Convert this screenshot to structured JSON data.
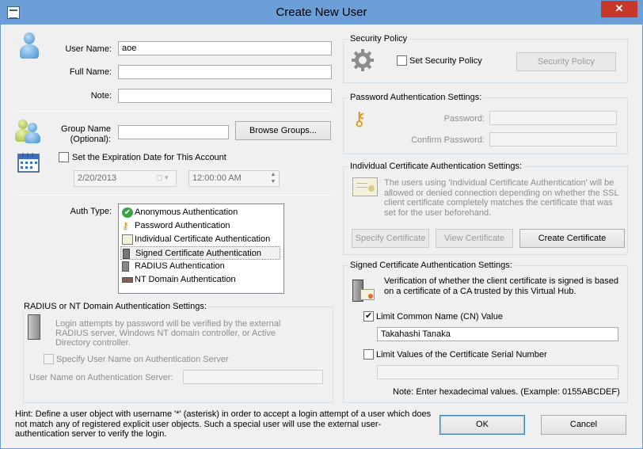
{
  "window": {
    "title": "Create New User",
    "close_glyph": "✕"
  },
  "user": {
    "username_label": "User Name:",
    "username_value": "aoe",
    "fullname_label": "Full Name:",
    "fullname_value": "",
    "note_label": "Note:",
    "note_value": ""
  },
  "group": {
    "label_line1": "Group Name",
    "label_line2": "(Optional):",
    "value": "",
    "browse_button": "Browse Groups..."
  },
  "expiration": {
    "checkbox_label": "Set the Expiration Date for This Account",
    "checked": false,
    "date_value": "2/20/2013",
    "time_value": "12:00:00 AM"
  },
  "auth_type": {
    "label": "Auth Type:",
    "items": [
      "Anonymous Authentication",
      "Password Authentication",
      "Individual Certificate Authentication",
      "Signed Certificate Authentication",
      "RADIUS Authentication",
      "NT Domain Authentication"
    ],
    "selected_index": 3
  },
  "radius": {
    "title": "RADIUS or NT Domain Authentication Settings:",
    "description": "Login attempts by password will be verified by the external RADIUS server, Windows NT domain controller, or Active Directory controller.",
    "specify_checkbox": "Specify User Name on Authentication Server",
    "server_username_label": "User Name on Authentication Server:",
    "server_username_value": ""
  },
  "hint": "Hint: Define a user object with username '*' (asterisk) in order to accept a login attempt of a user which does not match any of registered explicit user objects. Such a special user will use the external user-authentication server to verify the login.",
  "security_policy": {
    "title": "Security Policy",
    "checkbox_label": "Set Security Policy",
    "button": "Security Policy"
  },
  "password_auth": {
    "title": "Password Authentication Settings:",
    "password_label": "Password:",
    "confirm_label": "Confirm Password:"
  },
  "individual_cert": {
    "title": "Individual Certificate Authentication Settings:",
    "description": "The users using 'Individual Certificate Authentication' will be allowed or denied connection depending on whether the SSL client certificate completely matches the certificate that was set for the user beforehand.",
    "specify_button": "Specify Certificate",
    "view_button": "View Certificate",
    "create_button": "Create Certificate"
  },
  "signed_cert": {
    "title": "Signed Certificate Authentication Settings:",
    "description": "Verification of whether the client certificate is signed is based on a certificate of a CA trusted by this Virtual Hub.",
    "cn_checkbox": "Limit Common Name (CN) Value",
    "cn_checked": true,
    "cn_value": "Takahashi Tanaka",
    "serial_checkbox": "Limit Values of the Certificate Serial Number",
    "serial_checked": false,
    "serial_value": "",
    "note": "Note: Enter hexadecimal values. (Example: 0155ABCDEF)"
  },
  "buttons": {
    "ok": "OK",
    "cancel": "Cancel"
  }
}
